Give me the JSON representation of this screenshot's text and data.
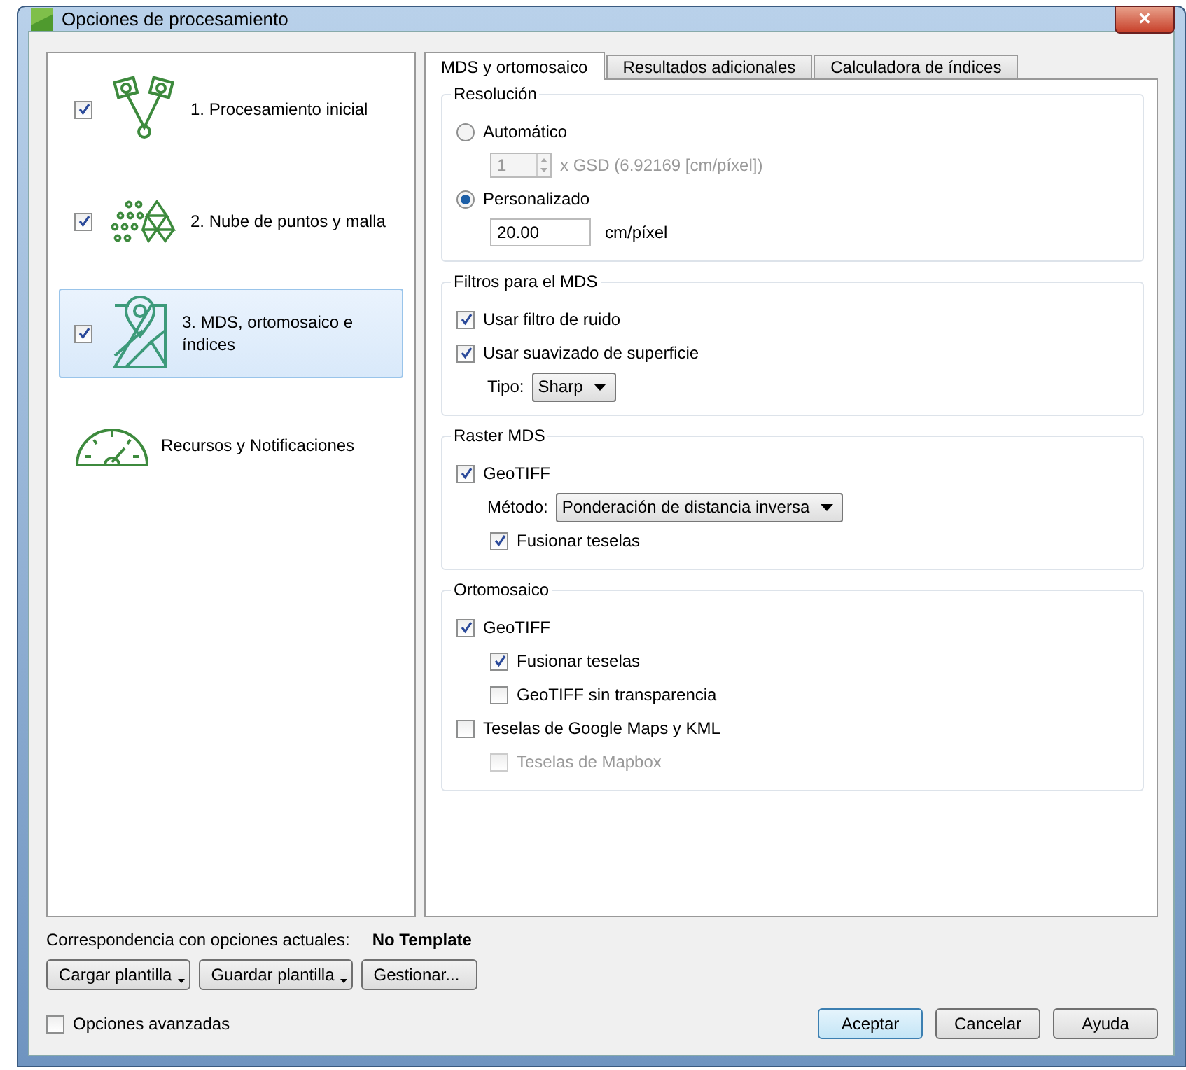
{
  "window": {
    "title": "Opciones de procesamiento",
    "close": "×"
  },
  "steps": [
    {
      "kind": "step",
      "label": "1. Procesamiento inicial",
      "checked": true,
      "selected": false
    },
    {
      "kind": "step",
      "label": "2. Nube de puntos y malla",
      "checked": true,
      "selected": false
    },
    {
      "kind": "step",
      "label": "3. MDS, ortomosaico e índices",
      "checked": true,
      "selected": true
    },
    {
      "kind": "resources",
      "label": "Recursos y Notificaciones",
      "selected": false
    }
  ],
  "tabs": [
    {
      "label": "MDS y ortomosaico",
      "selected": true
    },
    {
      "label": "Resultados adicionales",
      "selected": false
    },
    {
      "label": "Calculadora de índices",
      "selected": false
    }
  ],
  "sections": [
    {
      "title": "Resolución",
      "items": [
        {
          "kind": "radio",
          "label": "Automático",
          "selected": false,
          "children": [
            {
              "kind": "spin",
              "value": "1",
              "suffix": "x GSD (6.92169 [cm/píxel])",
              "disabled": true
            }
          ]
        },
        {
          "kind": "radio",
          "label": "Personalizado",
          "selected": true,
          "children": [
            {
              "kind": "input",
              "value": "20.00",
              "suffix": "cm/píxel"
            }
          ]
        }
      ]
    },
    {
      "title": "Filtros para el MDS",
      "items": [
        {
          "kind": "checkbox",
          "label": "Usar filtro de ruido",
          "checked": true
        },
        {
          "kind": "checkbox",
          "label": "Usar suavizado de superficie",
          "checked": true,
          "children": [
            {
              "kind": "select",
              "label": "Tipo:",
              "value": "Sharp"
            }
          ]
        }
      ]
    },
    {
      "title": "Raster MDS",
      "items": [
        {
          "kind": "checkbox",
          "label": "GeoTIFF",
          "checked": true,
          "children": [
            {
              "kind": "select",
              "label": "Método:",
              "value": "Ponderación de distancia inversa"
            },
            {
              "kind": "checkbox",
              "label": "Fusionar teselas",
              "checked": true
            }
          ]
        }
      ]
    },
    {
      "title": "Ortomosaico",
      "items": [
        {
          "kind": "checkbox",
          "label": "GeoTIFF",
          "checked": true,
          "children": [
            {
              "kind": "checkbox",
              "label": "Fusionar teselas",
              "checked": true
            },
            {
              "kind": "checkbox",
              "label": "GeoTIFF sin transparencia",
              "checked": false
            }
          ]
        },
        {
          "kind": "checkbox",
          "label": "Teselas de Google Maps y KML",
          "checked": false,
          "children": [
            {
              "kind": "checkbox",
              "label": "Teselas de Mapbox",
              "checked": false,
              "disabled": true
            }
          ]
        }
      ]
    }
  ],
  "template": {
    "label": "Correspondencia con opciones actuales:",
    "value": "No Template"
  },
  "template_buttons": [
    {
      "label": "Cargar plantilla",
      "menu": true
    },
    {
      "label": "Guardar plantilla",
      "menu": true
    },
    {
      "label": "Gestionar...",
      "menu": false
    }
  ],
  "advanced": {
    "label": "Opciones avanzadas",
    "checked": false
  },
  "buttons": [
    {
      "label": "Aceptar",
      "default": true
    },
    {
      "label": "Cancelar",
      "default": false
    },
    {
      "label": "Ayuda",
      "default": false
    }
  ]
}
